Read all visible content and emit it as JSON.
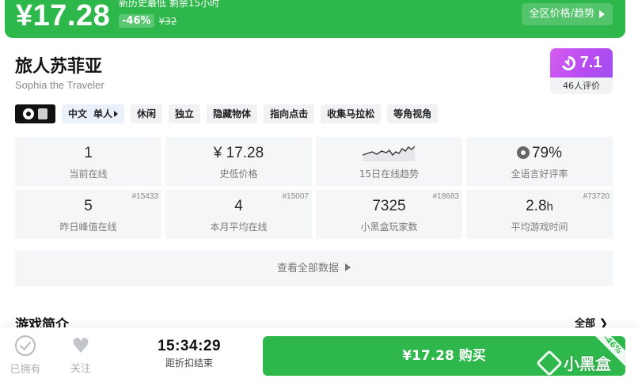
{
  "banner": {
    "price": "¥17.28",
    "history_note": "新历史最低 剩余15小时",
    "discount": "-46%",
    "original_price": "¥32",
    "trend_button": "全区价格/趋势"
  },
  "game": {
    "title": "旅人苏菲亚",
    "subtitle": "Sophia the Traveler",
    "score": "7.1",
    "rating_count": "46人评价"
  },
  "tags": {
    "language": "中文",
    "player_mode": "单人",
    "items": [
      "休闲",
      "独立",
      "隐藏物体",
      "指向点击",
      "收集马拉松",
      "等角视角"
    ]
  },
  "stats": [
    {
      "value": "1",
      "label": "当前在线"
    },
    {
      "value": "¥ 17.28",
      "label": "史低价格"
    },
    {
      "label": "15日在线趋势"
    },
    {
      "value": "79%",
      "label": "全语言好评率"
    },
    {
      "value": "5",
      "label": "昨日峰值在线",
      "rank": "#15433"
    },
    {
      "value": "4",
      "label": "本月平均在线",
      "rank": "#15007"
    },
    {
      "value": "7325",
      "label": "小黑盒玩家数",
      "rank": "#18683"
    },
    {
      "value": "2.8",
      "unit": "h",
      "label": "平均游戏时间",
      "rank": "#73720"
    }
  ],
  "all_data_label": "查看全部数据",
  "section": {
    "title": "游戏简介",
    "all_label": "全部"
  },
  "bottom": {
    "owned_label": "已拥有",
    "follow_label": "关注",
    "countdown_time": "15:34:29",
    "countdown_label": "距折扣结束",
    "buy_label": "¥17.28 购买",
    "buy_corner_discount": "-46%",
    "watermark": "小黑盒"
  },
  "colors": {
    "accent_green": "#2eb84b",
    "score_purple": "#b54cf2"
  }
}
